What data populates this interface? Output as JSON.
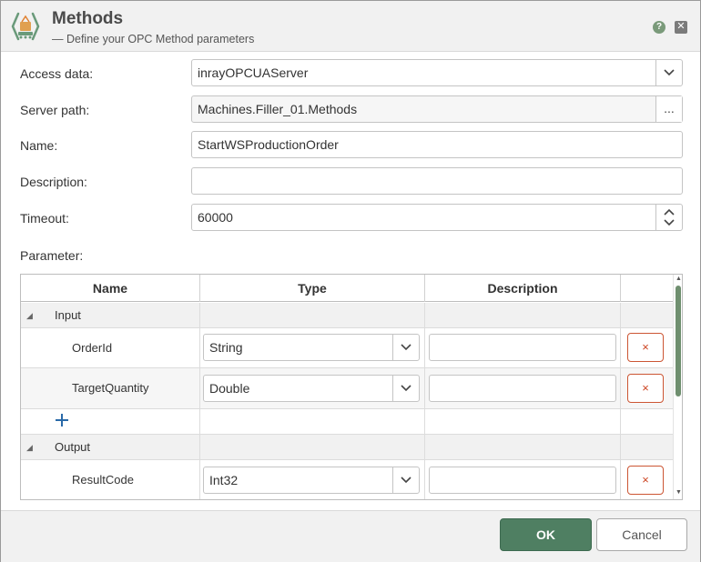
{
  "header": {
    "title": "Methods",
    "subtitle": "— Define your OPC Method parameters",
    "help_label": "?",
    "close_label": "✕"
  },
  "form": {
    "access_data": {
      "label": "Access data:",
      "value": "inrayOPCUAServer"
    },
    "server_path": {
      "label": "Server path:",
      "value": "Machines.Filler_01.Methods",
      "browse_label": "..."
    },
    "name": {
      "label": "Name:",
      "value": "StartWSProductionOrder"
    },
    "description": {
      "label": "Description:",
      "value": ""
    },
    "timeout": {
      "label": "Timeout:",
      "value": "60000"
    },
    "parameter_label": "Parameter:"
  },
  "grid": {
    "columns": [
      "Name",
      "Type",
      "Description"
    ],
    "groups": [
      {
        "label": "Input",
        "rows": [
          {
            "name": "OrderId",
            "type": "String",
            "description": ""
          },
          {
            "name": "TargetQuantity",
            "type": "Double",
            "description": ""
          }
        ]
      },
      {
        "label": "Output",
        "rows": [
          {
            "name": "ResultCode",
            "type": "Int32",
            "description": ""
          }
        ]
      }
    ],
    "delete_label": "×",
    "add_icon": "plus-icon"
  },
  "footer": {
    "ok_label": "OK",
    "cancel_label": "Cancel"
  },
  "colors": {
    "accent": "#4f7f62",
    "delete": "#cc4422",
    "header_bg": "#f1f1f1"
  }
}
